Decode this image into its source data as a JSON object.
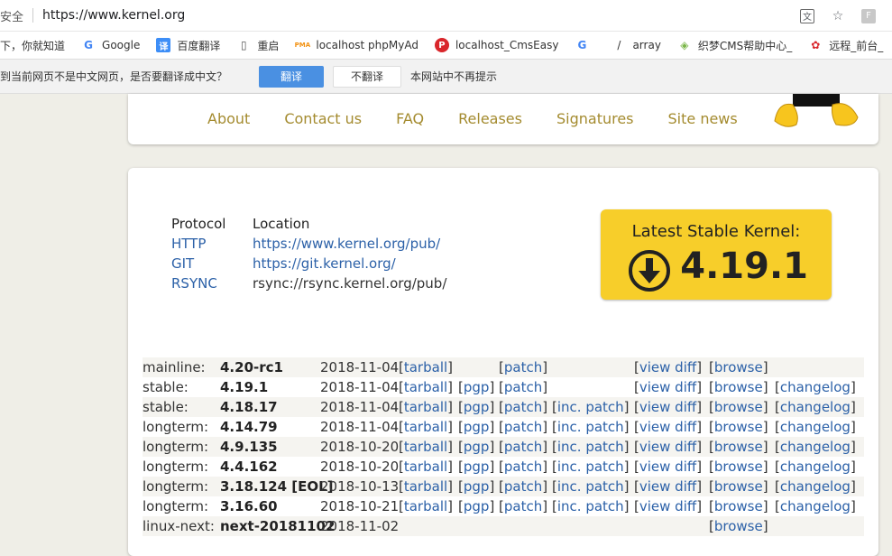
{
  "browser": {
    "security_label": "安全",
    "url": "https://www.kernel.org",
    "right_icons": [
      "translate-icon",
      "star-icon",
      "profile-avatar"
    ],
    "avatar_letter": "F"
  },
  "bookmarks": [
    {
      "label": "下，你就知道",
      "icon": ""
    },
    {
      "label": "Google",
      "icon": "G"
    },
    {
      "label": "百度翻译",
      "icon": "译"
    },
    {
      "label": "重启",
      "icon": "📄"
    },
    {
      "label": "localhost phpMyAd",
      "icon": "PMA"
    },
    {
      "label": "localhost_CmsEasy",
      "icon": "P"
    },
    {
      "label": "",
      "icon": "G"
    },
    {
      "label": "array",
      "icon": "/"
    },
    {
      "label": "织梦CMS帮助中心_",
      "icon": "◈"
    },
    {
      "label": "远程_前台_",
      "icon": "✿"
    }
  ],
  "translate_bar": {
    "message": "到当前网页不是中文网页，是否要翻译成中文？",
    "translate_btn": "翻译",
    "dont_translate_btn": "不翻译",
    "never_label": "本网站中不再提示"
  },
  "nav": {
    "links": [
      "About",
      "Contact us",
      "FAQ",
      "Releases",
      "Signatures",
      "Site news"
    ]
  },
  "protocols": {
    "header_protocol": "Protocol",
    "header_location": "Location",
    "rows": [
      {
        "protocol": "HTTP",
        "location": "https://www.kernel.org/pub/",
        "link": true
      },
      {
        "protocol": "GIT",
        "location": "https://git.kernel.org/",
        "link": true
      },
      {
        "protocol": "RSYNC",
        "location": "rsync://rsync.kernel.org/pub/",
        "link": false
      }
    ]
  },
  "latest": {
    "label": "Latest Stable Kernel:",
    "version": "4.19.1"
  },
  "releases": [
    {
      "type": "mainline:",
      "version": "4.20-rc1",
      "date": "2018-11-04",
      "tarball": "tarball",
      "pgp": "",
      "patch": "patch",
      "inc_patch": "",
      "view_diff": "view diff",
      "browse": "browse",
      "changelog": ""
    },
    {
      "type": "stable:",
      "version": "4.19.1",
      "date": "2018-11-04",
      "tarball": "tarball",
      "pgp": "pgp",
      "patch": "patch",
      "inc_patch": "",
      "view_diff": "view diff",
      "browse": "browse",
      "changelog": "changelog"
    },
    {
      "type": "stable:",
      "version": "4.18.17",
      "date": "2018-11-04",
      "tarball": "tarball",
      "pgp": "pgp",
      "patch": "patch",
      "inc_patch": "inc. patch",
      "view_diff": "view diff",
      "browse": "browse",
      "changelog": "changelog"
    },
    {
      "type": "longterm:",
      "version": "4.14.79",
      "date": "2018-11-04",
      "tarball": "tarball",
      "pgp": "pgp",
      "patch": "patch",
      "inc_patch": "inc. patch",
      "view_diff": "view diff",
      "browse": "browse",
      "changelog": "changelog"
    },
    {
      "type": "longterm:",
      "version": "4.9.135",
      "date": "2018-10-20",
      "tarball": "tarball",
      "pgp": "pgp",
      "patch": "patch",
      "inc_patch": "inc. patch",
      "view_diff": "view diff",
      "browse": "browse",
      "changelog": "changelog"
    },
    {
      "type": "longterm:",
      "version": "4.4.162",
      "date": "2018-10-20",
      "tarball": "tarball",
      "pgp": "pgp",
      "patch": "patch",
      "inc_patch": "inc. patch",
      "view_diff": "view diff",
      "browse": "browse",
      "changelog": "changelog"
    },
    {
      "type": "longterm:",
      "version": "3.18.124 [EOL]",
      "date": "2018-10-13",
      "tarball": "tarball",
      "pgp": "pgp",
      "patch": "patch",
      "inc_patch": "inc. patch",
      "view_diff": "view diff",
      "browse": "browse",
      "changelog": "changelog"
    },
    {
      "type": "longterm:",
      "version": "3.16.60",
      "date": "2018-10-21",
      "tarball": "tarball",
      "pgp": "pgp",
      "patch": "patch",
      "inc_patch": "inc. patch",
      "view_diff": "view diff",
      "browse": "browse",
      "changelog": "changelog"
    },
    {
      "type": "linux-next:",
      "version": "next-20181102",
      "date": "2018-11-02",
      "tarball": "",
      "pgp": "",
      "patch": "",
      "inc_patch": "",
      "view_diff": "",
      "browse": "browse",
      "changelog": ""
    }
  ],
  "colors": {
    "link": "#2c61a8",
    "nav_link": "#a48b2f",
    "latest_bg": "#f7ce2a",
    "translate_btn": "#4a90e2"
  }
}
